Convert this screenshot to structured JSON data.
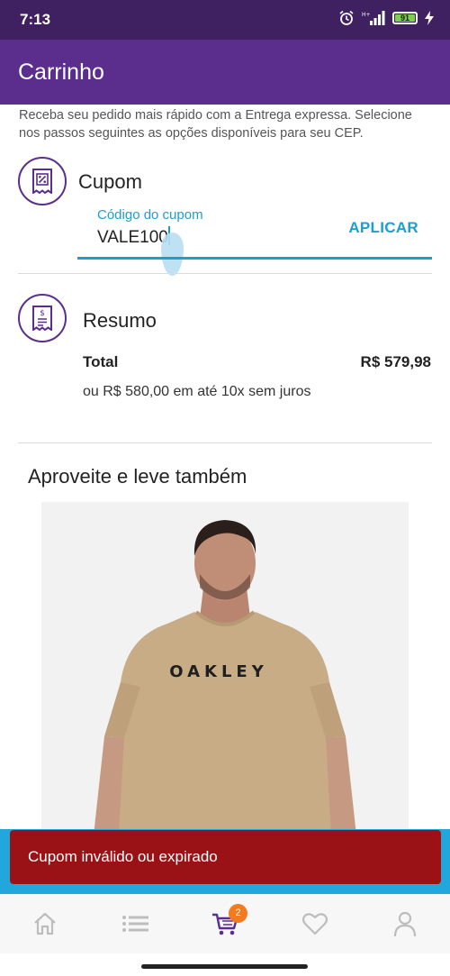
{
  "status_bar": {
    "time": "7:13",
    "battery": "91",
    "icons": [
      "alarm-icon",
      "signal-icon",
      "battery-icon",
      "charging-icon"
    ]
  },
  "app_bar": {
    "title": "Carrinho"
  },
  "intro": {
    "text": "Receba seu pedido mais rápido com a Entrega expressa. Selecione nos passos seguintes as opções disponíveis para seu CEP."
  },
  "coupon": {
    "title": "Cupom",
    "label": "Código do cupom",
    "value": "VALE100",
    "apply_label": "APLICAR",
    "icon": "coupon-receipt-icon"
  },
  "summary": {
    "title": "Resumo",
    "total_label": "Total",
    "total_value": "R$ 579,98",
    "installments": "ou R$ 580,00 em até 10x sem juros",
    "icon": "receipt-icon"
  },
  "recommendations": {
    "title": "Aproveite e leve também",
    "product_image_text": "OAKLEY"
  },
  "toast": {
    "message": "Cupom inválido ou expirado"
  },
  "bottom_nav": {
    "items": [
      "home-icon",
      "list-icon",
      "cart-icon",
      "heart-icon",
      "user-icon"
    ],
    "cart_badge": "2",
    "active_item": "cart-icon"
  },
  "colors": {
    "status_bar": "#3f2060",
    "app_bar": "#5b2d8c",
    "accent": "#1a9fd0",
    "toast": "#9b1216",
    "badge": "#f47a20"
  }
}
